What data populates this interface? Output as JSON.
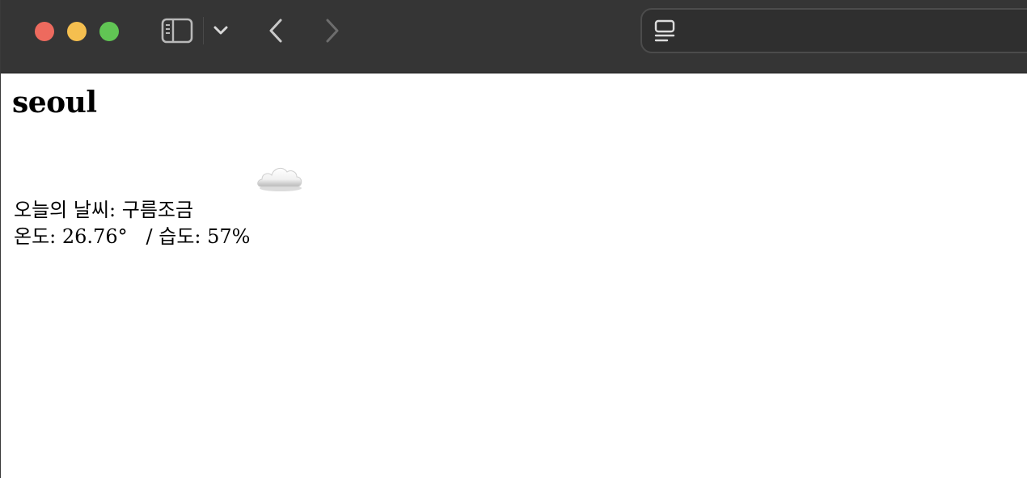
{
  "browser": {
    "toolbar": {
      "icons": {
        "sidebar": "sidebar-icon",
        "tab_overview": "chevron-down-icon",
        "back": "chevron-left-icon",
        "forward": "chevron-right-icon",
        "reader": "reader-icon"
      },
      "colors": {
        "toolbar_bg": "#353535",
        "close": "#ed6a5e",
        "minimize": "#f5bf4f",
        "maximize": "#61c554"
      }
    }
  },
  "page": {
    "city": "seoul",
    "weather_icon": "cloud-icon",
    "description": {
      "label": "오늘의 날씨:",
      "value": "구름조금"
    },
    "temperature": {
      "label": "온도:",
      "value": "26.76",
      "unit": "°"
    },
    "separator": "/",
    "humidity": {
      "label": "습도:",
      "value": "57",
      "unit": "%"
    }
  }
}
